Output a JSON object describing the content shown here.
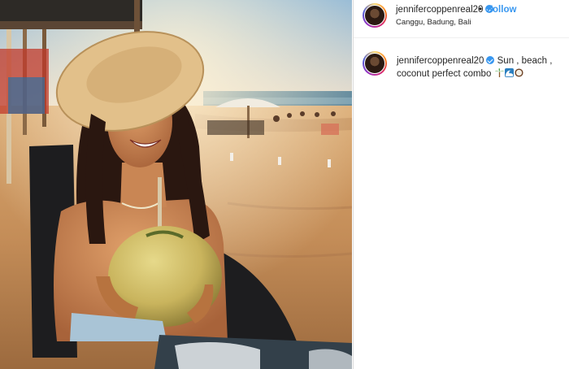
{
  "post": {
    "username": "jennifercoppenreal20",
    "separator": "•",
    "follow_label": "Follow",
    "location": "Canggu, Badung, Bali",
    "caption_text_line1": "Sun , beach ,",
    "caption_text_line2": "coconut perfect combo"
  },
  "icons": {
    "verified": "verified-badge-icon",
    "emojis": [
      "palm-tree-icon",
      "wave-icon",
      "coconut-icon"
    ]
  },
  "colors": {
    "link_blue": "#3897f0",
    "text": "#262626",
    "border": "#dbdbdb"
  }
}
